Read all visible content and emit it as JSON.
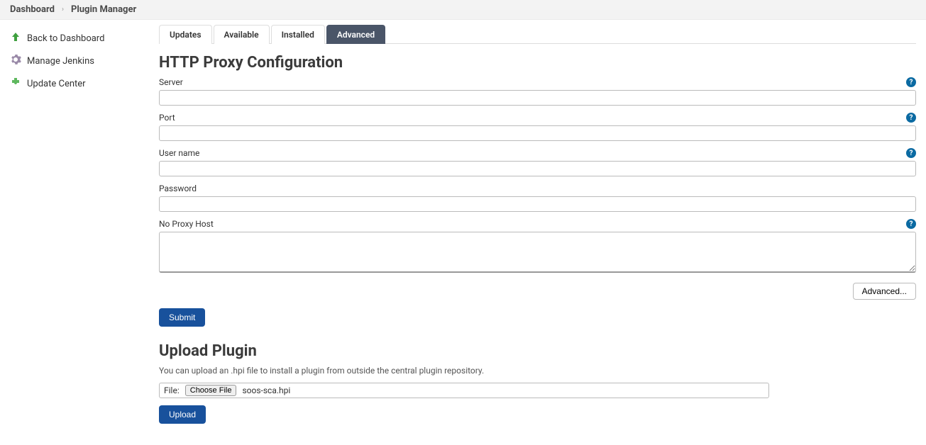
{
  "breadcrumb": {
    "dashboard": "Dashboard",
    "plugin_manager": "Plugin Manager"
  },
  "sidebar": {
    "back": "Back to Dashboard",
    "manage": "Manage Jenkins",
    "update_center": "Update Center"
  },
  "tabs": {
    "updates": "Updates",
    "available": "Available",
    "installed": "Installed",
    "advanced": "Advanced"
  },
  "proxy": {
    "heading": "HTTP Proxy Configuration",
    "server_label": "Server",
    "server_value": "",
    "port_label": "Port",
    "port_value": "",
    "username_label": "User name",
    "username_value": "",
    "password_label": "Password",
    "password_value": "",
    "no_proxy_label": "No Proxy Host",
    "no_proxy_value": "",
    "advanced_button": "Advanced...",
    "submit_button": "Submit"
  },
  "upload": {
    "heading": "Upload Plugin",
    "description": "You can upload an .hpi file to install a plugin from outside the central plugin repository.",
    "file_label": "File:",
    "choose_file_button": "Choose File",
    "file_name": "soos-sca.hpi",
    "upload_button": "Upload"
  },
  "help_glyph": "?"
}
